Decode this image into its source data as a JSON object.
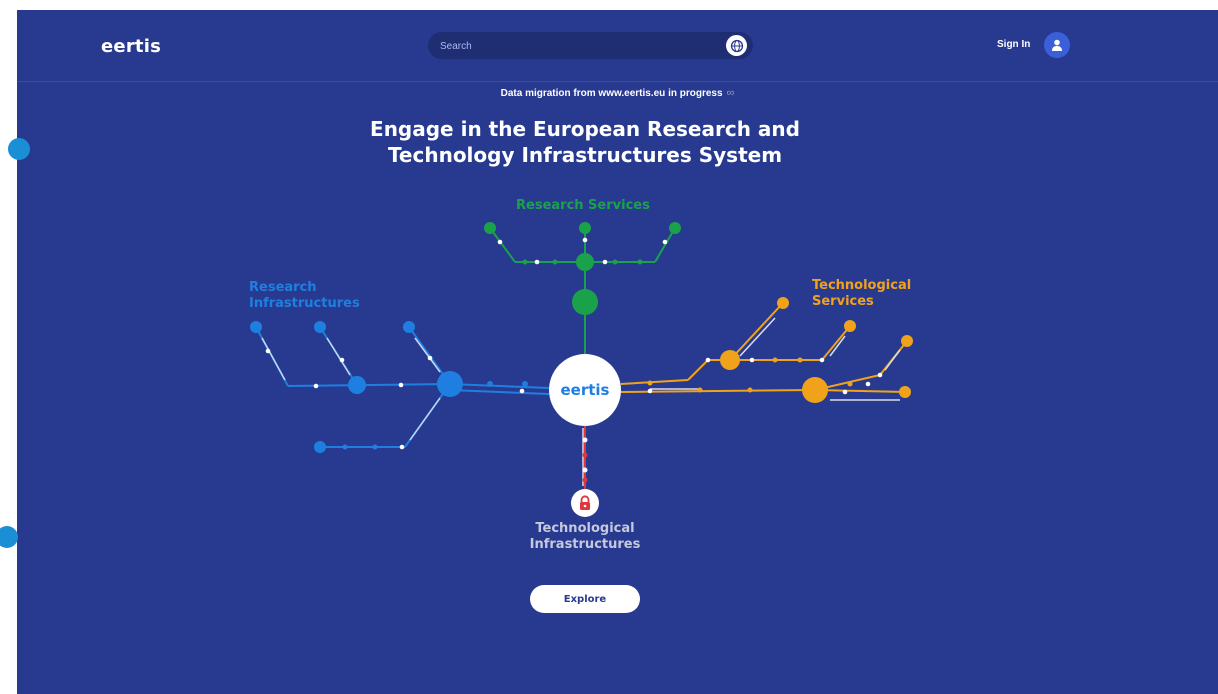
{
  "header": {
    "logo": "eertis",
    "search_placeholder": "Search",
    "sign_in": "Sign In"
  },
  "banner": {
    "migration_text": "Data migration from www.eertis.eu in progress",
    "headline_line1": "Engage in the European Research and",
    "headline_line2": "Technology Infrastructures System"
  },
  "diagram": {
    "center_label": "eertis",
    "categories": {
      "research_services": "Research Services",
      "research_infrastructures_line1": "Research",
      "research_infrastructures_line2": "Infrastructures",
      "technological_services_line1": "Technological",
      "technological_services_line2": "Services",
      "technological_infrastructures_line1": "Technological",
      "technological_infrastructures_line2": "Infrastructures"
    },
    "colors": {
      "research_services": "#1aa24b",
      "research_infrastructures": "#1f7fe0",
      "technological_services": "#f0a21b",
      "technological_infrastructures": "#e0353b",
      "background": "#283a8f"
    }
  },
  "actions": {
    "explore": "Explore"
  },
  "icons": {
    "search": "globe-icon",
    "avatar": "user-icon",
    "migration": "infinity-icon",
    "lock": "lock-icon"
  }
}
